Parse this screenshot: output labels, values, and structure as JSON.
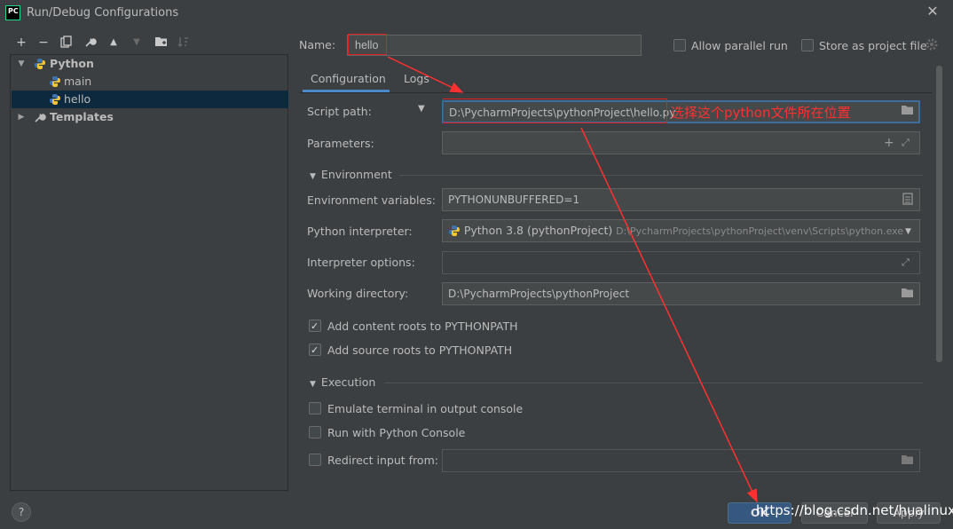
{
  "window": {
    "app_icon_text": "PC",
    "title": "Run/Debug Configurations"
  },
  "toolbar": {
    "buttons": [
      "add-icon",
      "remove-icon",
      "copy-icon",
      "wrench-icon",
      "move-up-icon",
      "move-down-icon",
      "folder-icon",
      "sort-icon"
    ]
  },
  "tree": {
    "python": {
      "label": "Python"
    },
    "items": [
      {
        "label": "main"
      },
      {
        "label": "hello"
      }
    ],
    "templates": {
      "label": "Templates"
    }
  },
  "name": {
    "label": "Name:",
    "value": "hello"
  },
  "options": {
    "allow_parallel": "Allow parallel run",
    "store_project": "Store as project file"
  },
  "tabs": [
    {
      "label": "Configuration"
    },
    {
      "label": "Logs"
    }
  ],
  "form": {
    "script_path": {
      "label": "Script path:",
      "value": "D:\\PycharmProjects\\pythonProject\\hello.py",
      "annotation": "选择这个python文件所在位置"
    },
    "parameters": {
      "label": "Parameters:",
      "value": ""
    },
    "environment": {
      "label": "Environment"
    },
    "env_vars": {
      "label": "Environment variables:",
      "value": "PYTHONUNBUFFERED=1"
    },
    "interpreter": {
      "label": "Python interpreter:",
      "name": "Python 3.8 (pythonProject)",
      "path": "D:\\PycharmProjects\\pythonProject\\venv\\Scripts\\python.exe"
    },
    "interpreter_options": {
      "label": "Interpreter options:",
      "value": ""
    },
    "working_dir": {
      "label": "Working directory:",
      "value": "D:\\PycharmProjects\\pythonProject"
    },
    "content_roots": {
      "label": "Add content roots to PYTHONPATH",
      "checked": true
    },
    "source_roots": {
      "label": "Add source roots to PYTHONPATH",
      "checked": true
    },
    "execution": {
      "label": "Execution"
    },
    "emulate_terminal": {
      "label": "Emulate terminal in output console",
      "checked": false
    },
    "python_console": {
      "label": "Run with Python Console",
      "checked": false
    },
    "redirect_input": {
      "label": "Redirect input from:",
      "checked": false,
      "value": ""
    }
  },
  "footer": {
    "help": "?",
    "ok": "OK",
    "cancel": "Cancel",
    "apply": "Apply",
    "watermark": "https://blog.csdn.net/hualinux"
  },
  "colors": {
    "accent": "#4a88c7",
    "annotation": "#ff3030",
    "selection": "#0d293e"
  }
}
